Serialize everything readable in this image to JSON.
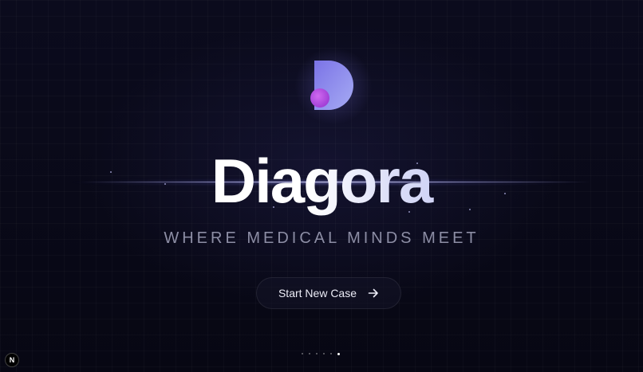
{
  "brand": {
    "name": "Diagora",
    "tagline": "WHERE MEDICAL MINDS MEET",
    "logo_icon": "d-letter-logo-icon"
  },
  "cta": {
    "label": "Start New Case",
    "icon": "arrow-right-icon"
  },
  "pagination": {
    "total": 6,
    "active_index": 5
  },
  "dev_badge": {
    "label": "N"
  },
  "colors": {
    "background": "#080815",
    "accent_purple": "#9ea4ea",
    "logo_dot": "#c24fe0",
    "tagline": "#8d8ea5"
  }
}
